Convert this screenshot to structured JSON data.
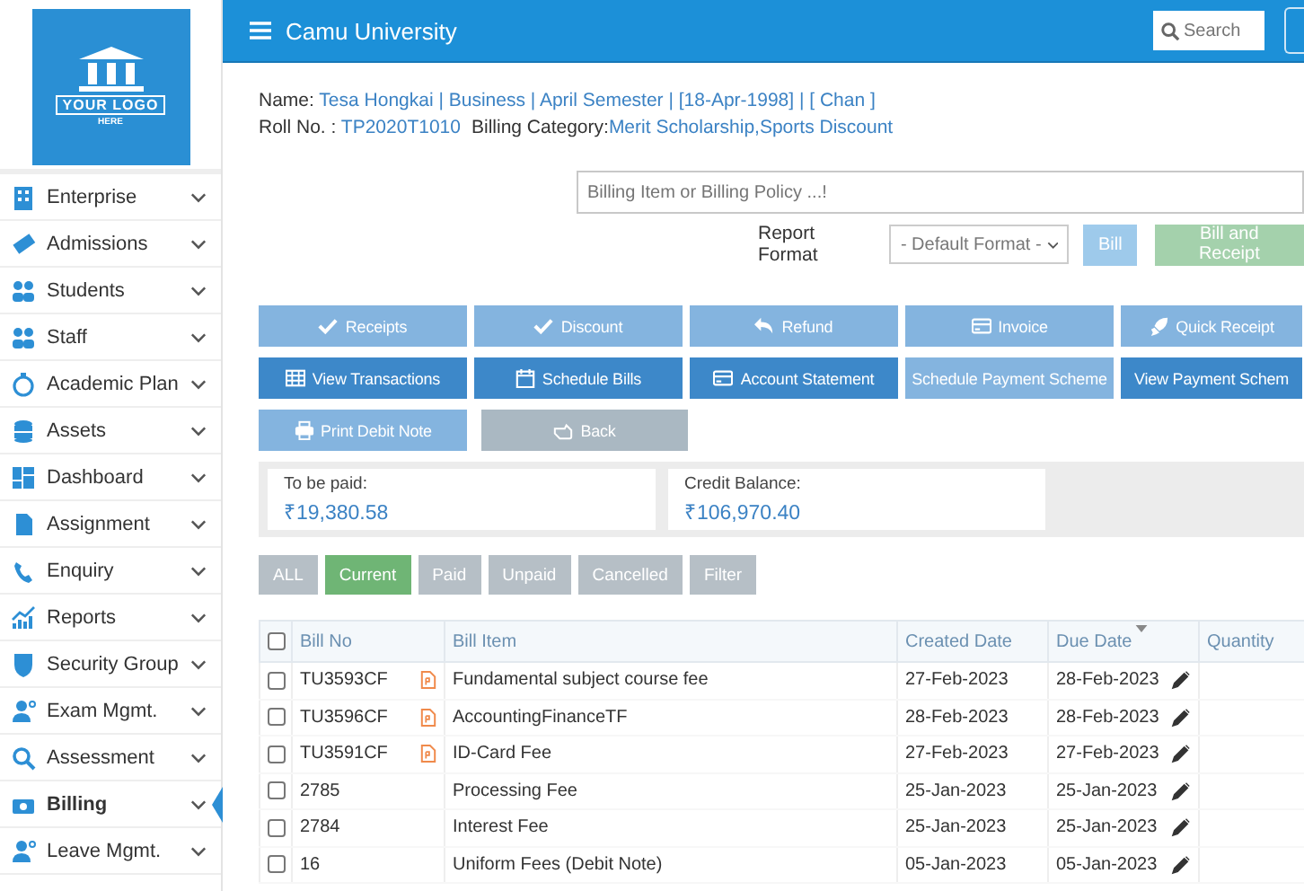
{
  "logo": {
    "line1": "YOUR LOGO",
    "line2": "HERE"
  },
  "sidebar": {
    "items": [
      {
        "label": "Enterprise",
        "selected": false
      },
      {
        "label": "Admissions",
        "selected": false
      },
      {
        "label": "Students",
        "selected": false
      },
      {
        "label": "Staff",
        "selected": false
      },
      {
        "label": "Academic Plan",
        "selected": false
      },
      {
        "label": "Assets",
        "selected": false
      },
      {
        "label": "Dashboard",
        "selected": false
      },
      {
        "label": "Assignment",
        "selected": false
      },
      {
        "label": "Enquiry",
        "selected": false
      },
      {
        "label": "Reports",
        "selected": false
      },
      {
        "label": "Security Group",
        "selected": false
      },
      {
        "label": "Exam Mgmt.",
        "selected": false
      },
      {
        "label": "Assessment",
        "selected": false
      },
      {
        "label": "Billing",
        "selected": true
      },
      {
        "label": "Leave Mgmt.",
        "selected": false
      }
    ]
  },
  "header": {
    "title": "Camu University",
    "search": {
      "placeholder": "Search"
    }
  },
  "student": {
    "name_label": "Name:",
    "name_value": "Tesa Hongkai | Business | April Semester | [18-Apr-1998] | [ Chan ]",
    "roll_label": "Roll No. :",
    "roll_value": "TP2020T1010",
    "category_label": "Billing Category:",
    "category_value": "Merit Scholarship,Sports Discount"
  },
  "billing_search": {
    "placeholder": "Billing Item or Billing Policy ...!"
  },
  "report_format": {
    "label": "Report Format",
    "value": "- Default Format -"
  },
  "submit_buttons": [
    {
      "label": "Bill",
      "kind": "blue",
      "disabled": true
    },
    {
      "label": "Bill and Receipt",
      "kind": "green",
      "disabled": true
    }
  ],
  "actions": [
    {
      "label": "Receipts",
      "kind": "light"
    },
    {
      "label": "Discount",
      "kind": "light"
    },
    {
      "label": "Refund",
      "kind": "light"
    },
    {
      "label": "Invoice",
      "kind": "light"
    },
    {
      "label": "Quick Receipt",
      "kind": "light"
    },
    {
      "label": "View Transactions",
      "kind": "dark"
    },
    {
      "label": "Schedule Bills",
      "kind": "dark"
    },
    {
      "label": "Account Statement",
      "kind": "dark"
    },
    {
      "label": "Schedule Payment Scheme",
      "kind": "light"
    },
    {
      "label": "View Payment Schem",
      "kind": "dark"
    },
    {
      "label": "Print Debit Note",
      "kind": "light"
    },
    {
      "label": "Back",
      "kind": "grey"
    }
  ],
  "summary": [
    {
      "label": "To be paid:",
      "value": "₹19,380.58"
    },
    {
      "label": "Credit Balance:",
      "value": "₹106,970.40"
    }
  ],
  "filters": [
    {
      "label": "ALL",
      "selected": false
    },
    {
      "label": "Current",
      "selected": true
    },
    {
      "label": "Paid",
      "selected": false
    },
    {
      "label": "Unpaid",
      "selected": false
    },
    {
      "label": "Cancelled",
      "selected": false
    },
    {
      "label": "Filter",
      "selected": false
    }
  ],
  "table": {
    "all_checked": false,
    "columns": [
      "Bill No",
      "Bill Item",
      "Created Date",
      "Due Date",
      "Quantity"
    ],
    "rows": [
      {
        "bill_no": "TU3593CF",
        "pdf": true,
        "item": "Fundamental subject course fee",
        "created": "27-Feb-2023",
        "due": "28-Feb-2023",
        "checked": false
      },
      {
        "bill_no": "TU3596CF",
        "pdf": true,
        "item": "AccountingFinanceTF",
        "created": "28-Feb-2023",
        "due": "28-Feb-2023",
        "checked": false
      },
      {
        "bill_no": "TU3591CF",
        "pdf": true,
        "item": "ID-Card Fee",
        "created": "27-Feb-2023",
        "due": "27-Feb-2023",
        "checked": false
      },
      {
        "bill_no": "2785",
        "pdf": false,
        "item": "Processing Fee",
        "created": "25-Jan-2023",
        "due": "25-Jan-2023",
        "checked": false
      },
      {
        "bill_no": "2784",
        "pdf": false,
        "item": "Interest Fee",
        "created": "25-Jan-2023",
        "due": "25-Jan-2023",
        "checked": false
      },
      {
        "bill_no": "16",
        "pdf": false,
        "item": "Uniform Fees (Debit Note)",
        "created": "05-Jan-2023",
        "due": "05-Jan-2023",
        "checked": false
      }
    ]
  }
}
